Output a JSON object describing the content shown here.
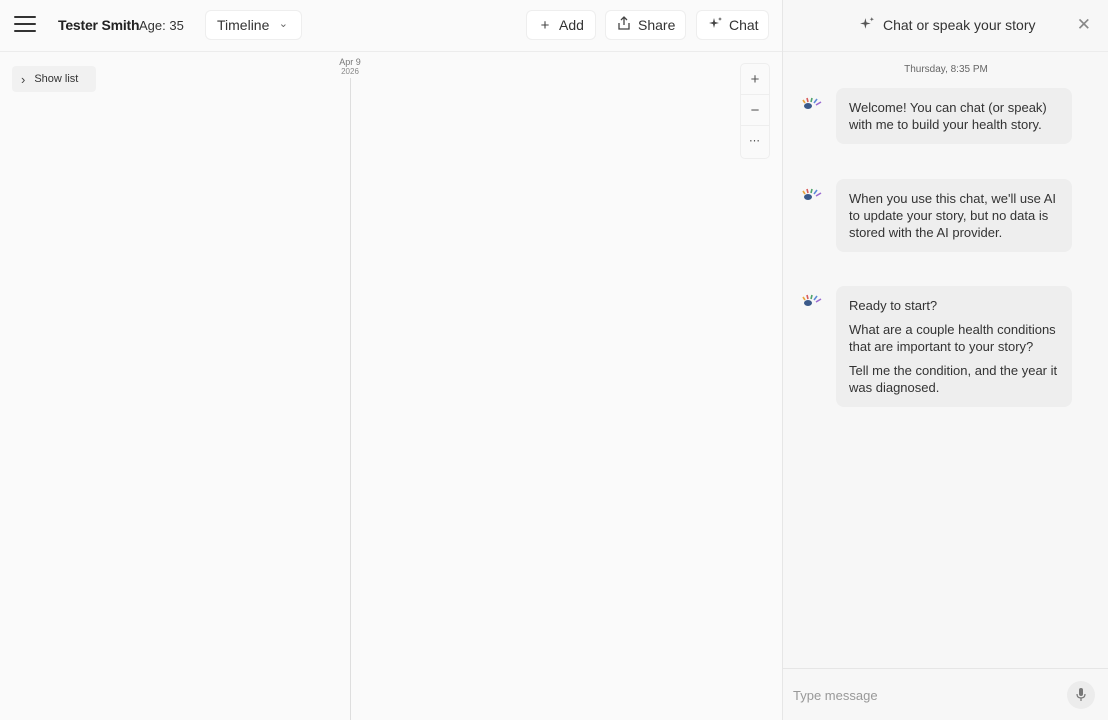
{
  "header": {
    "patient_name": "Tester Smith",
    "patient_age": "Age: 35",
    "view_select": "Timeline",
    "add_label": "Add",
    "share_label": "Share",
    "chat_label": "Chat"
  },
  "timeline": {
    "show_list_label": "Show list",
    "date_month_day": "Apr 9",
    "date_year": "2026",
    "zoom_in": "+",
    "zoom_out": "−",
    "more": "⋯"
  },
  "chat": {
    "title": "Chat or speak your story",
    "timestamp": "Thursday, 8:35 PM",
    "messages": [
      {
        "paragraphs": [
          "Welcome! You can chat (or speak) with me to build your health story."
        ]
      },
      {
        "paragraphs": [
          "When you use this chat, we'll use AI to update your story, but no data is stored with the AI provider."
        ]
      },
      {
        "paragraphs": [
          "Ready to start?",
          "What are a couple health conditions that are important to your story?",
          "Tell me the condition, and the year it was diagnosed."
        ]
      }
    ],
    "composer_placeholder": "Type message"
  },
  "icons": {
    "menu": "hamburger-menu-icon",
    "chevron": "chevron-down-icon",
    "add": "plus-icon",
    "share": "share-icon",
    "chat": "sparkle-icon",
    "close": "close-icon",
    "avatar": "eye-logo-icon",
    "mic": "microphone-icon"
  }
}
